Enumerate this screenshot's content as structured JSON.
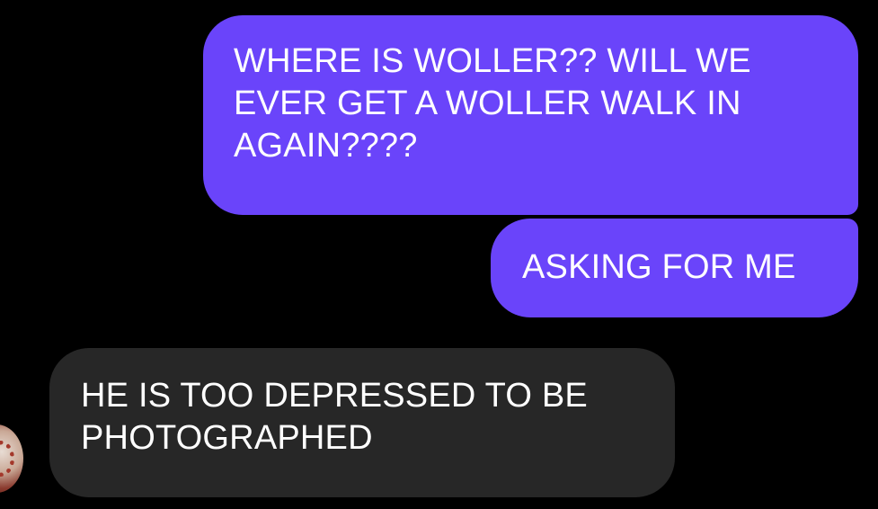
{
  "conversation": {
    "messages": [
      {
        "sender": "me",
        "text": "WHERE IS WOLLER?? WILL WE\nEVER GET A WOLLER WALK IN\nAGAIN????"
      },
      {
        "sender": "me",
        "text": "ASKING FOR ME"
      },
      {
        "sender": "other",
        "text": "HE IS TOO DEPRESSED TO BE\nPHOTOGRAPHED"
      }
    ]
  },
  "colors": {
    "background": "#000000",
    "sent_bubble": "#6a44fa",
    "received_bubble": "#272727",
    "text": "#ffffff"
  },
  "avatar": {
    "icon": "profile-photo-avatar"
  }
}
